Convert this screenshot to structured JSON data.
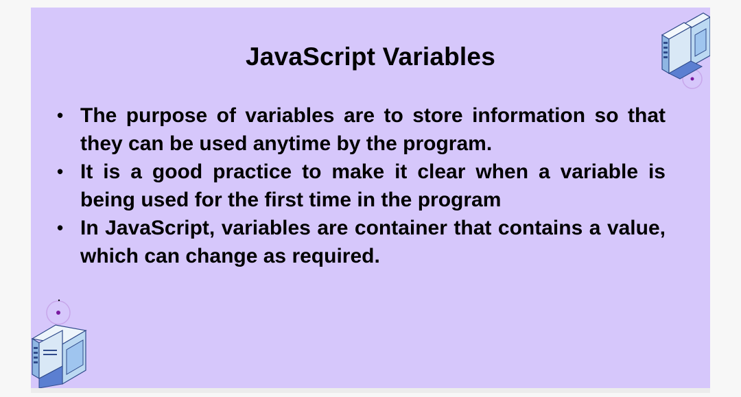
{
  "slide": {
    "title": "JavaScript Variables",
    "bullets": [
      "The purpose of variables are to store information so that they can be used anytime by the program.",
      "It is a good practice to make it clear when a variable is being used for the first time in the program",
      "In JavaScript, variables are container that contains a value, which can change as required."
    ],
    "bullet_symbol": "•",
    "background_color": "#d6c7fb",
    "decorations": [
      "server-illustration-icon",
      "server-illustration-icon"
    ]
  }
}
